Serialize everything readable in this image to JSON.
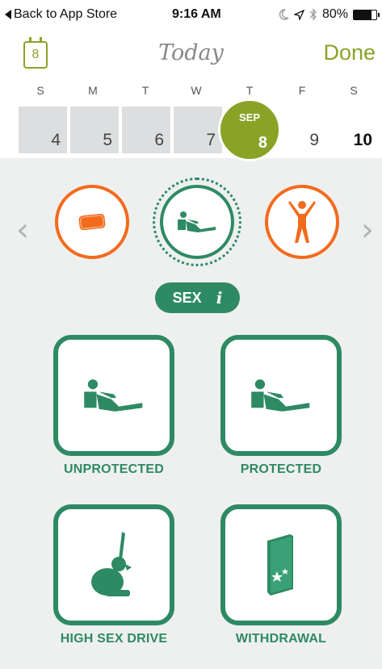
{
  "status_bar": {
    "back_label": "Back to App Store",
    "time": "9:16 AM",
    "battery_percent": "80%",
    "battery_level": 0.8
  },
  "nav": {
    "calendar_icon_number": "8",
    "title": "Today",
    "done_label": "Done"
  },
  "weekdays": [
    "S",
    "M",
    "T",
    "W",
    "T",
    "F",
    "S"
  ],
  "dates": [
    "4",
    "5",
    "6",
    "7",
    "8",
    "9",
    "10"
  ],
  "selected": {
    "month": "SEP",
    "day": "8"
  },
  "category": {
    "label": "SEX",
    "info_glyph": "i"
  },
  "options": [
    {
      "label": "UNPROTECTED",
      "icon": "reclining-person-icon"
    },
    {
      "label": "PROTECTED",
      "icon": "reclining-person-icon"
    },
    {
      "label": "HIGH SEX DRIVE",
      "icon": "rabbit-icon"
    },
    {
      "label": "WITHDRAWAL",
      "icon": "book-stars-icon"
    }
  ],
  "colors": {
    "accent_green": "#8aa327",
    "sex_green": "#2e8a63",
    "orange": "#f26b1d",
    "panel_bg": "#eef0f0"
  }
}
